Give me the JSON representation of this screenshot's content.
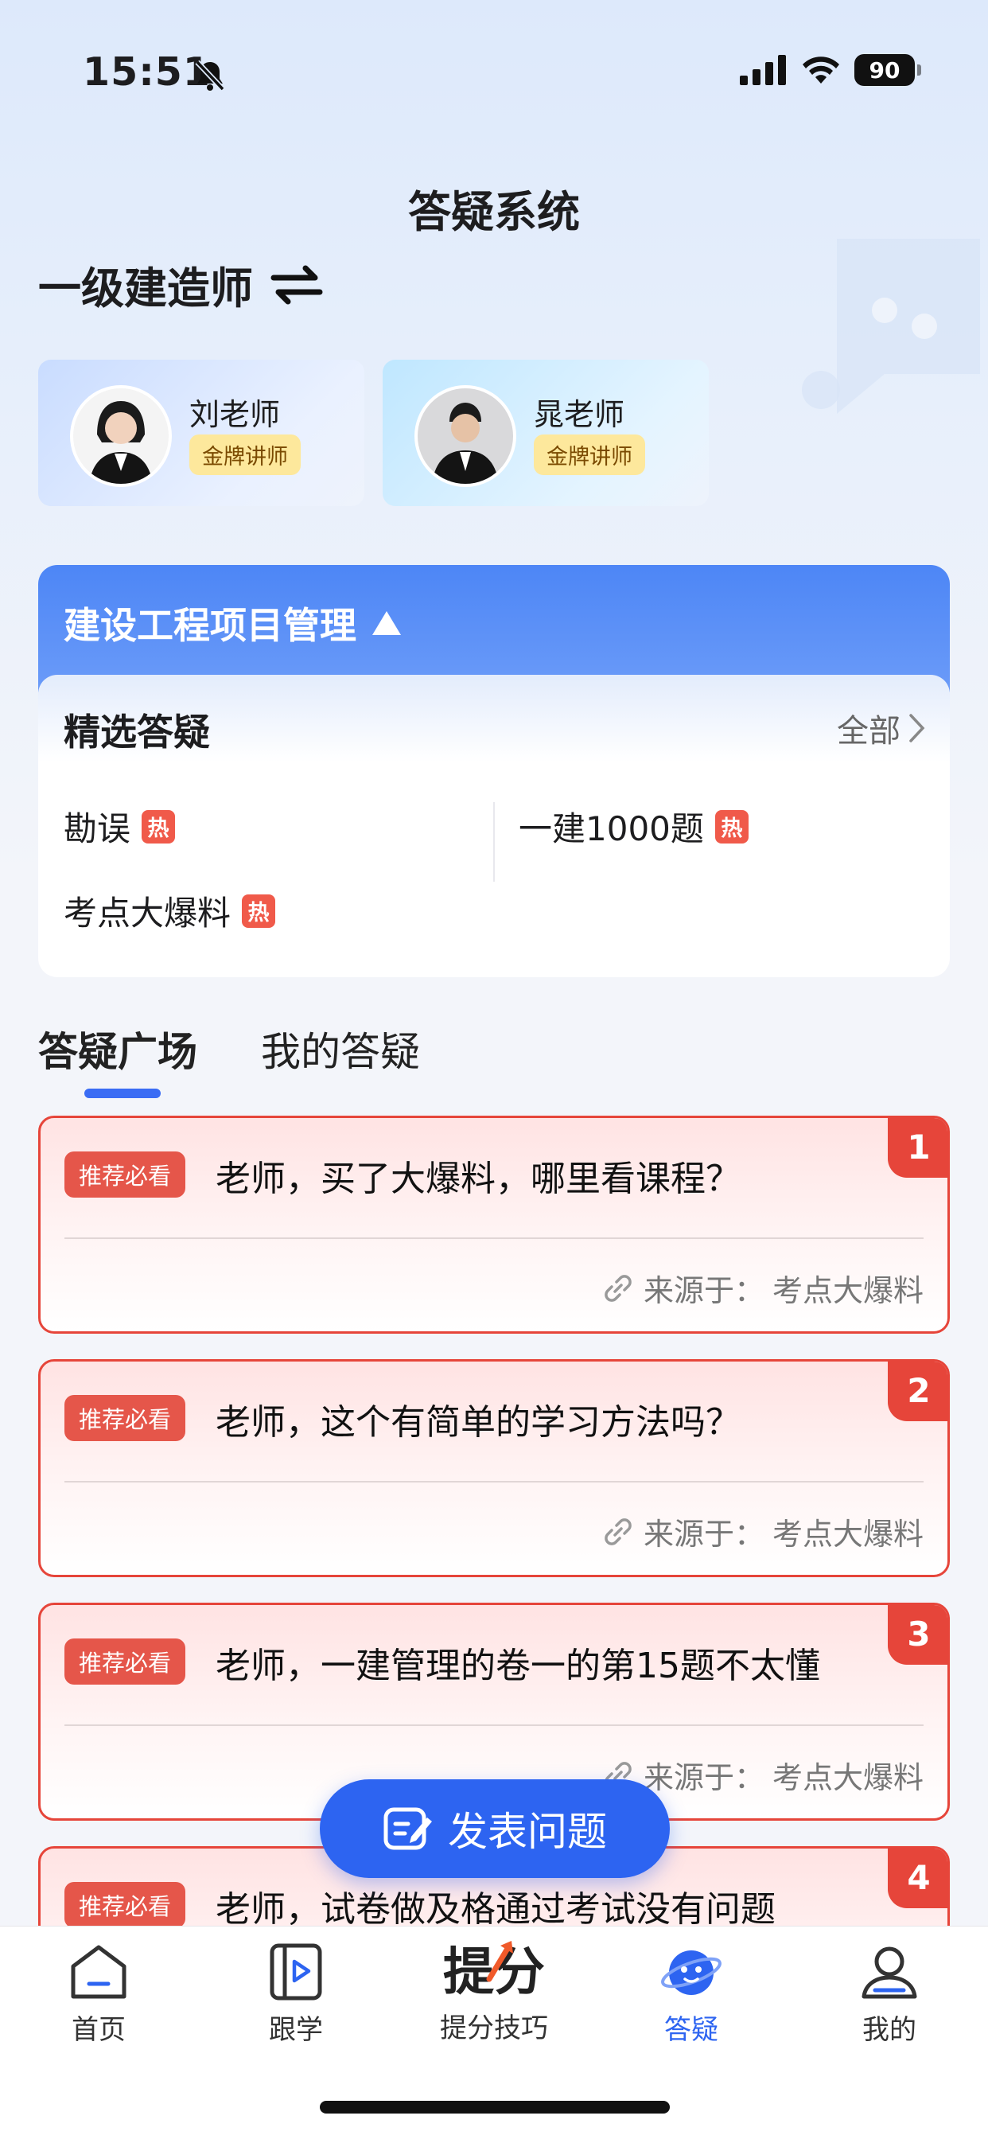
{
  "status_bar": {
    "time": "15:51",
    "battery": "90"
  },
  "header": {
    "title": "答疑系统"
  },
  "subject": {
    "title": "一级建造师"
  },
  "teachers": [
    {
      "name": "刘老师",
      "badge": "金牌讲师"
    },
    {
      "name": "晁老师",
      "badge": "金牌讲师"
    }
  ],
  "course": {
    "title": "建设工程项目管理"
  },
  "featured": {
    "title": "精选答疑",
    "all_label": "全部",
    "items": [
      {
        "label": "勘误",
        "hot": "热"
      },
      {
        "label": "一建1000题",
        "hot": "热"
      },
      {
        "label": "考点大爆料",
        "hot": "热"
      }
    ]
  },
  "tabs": [
    {
      "label": "答疑广场",
      "active": true
    },
    {
      "label": "我的答疑",
      "active": false
    }
  ],
  "questions": [
    {
      "rank": "1",
      "tag": "推荐必看",
      "text": "老师，买了大爆料，哪里看课程？",
      "source_label": "来源于：",
      "source": "考点大爆料"
    },
    {
      "rank": "2",
      "tag": "推荐必看",
      "text": "老师，这个有简单的学习方法吗？",
      "source_label": "来源于：",
      "source": "考点大爆料"
    },
    {
      "rank": "3",
      "tag": "推荐必看",
      "text": "老师，一建管理的卷一的第15题不太懂",
      "source_label": "来源于：",
      "source": "考点大爆料"
    },
    {
      "rank": "4",
      "tag": "推荐必看",
      "text": "老师，试卷做及格通过考试没有问题"
    }
  ],
  "fab": {
    "label": "发表问题"
  },
  "tabbar": [
    {
      "label": "首页",
      "icon": "home-icon"
    },
    {
      "label": "跟学",
      "icon": "play-book-icon"
    },
    {
      "label": "提分技巧",
      "logo_text": "提分",
      "icon": "score-up-logo"
    },
    {
      "label": "答疑",
      "icon": "qa-planet-icon",
      "active": true
    },
    {
      "label": "我的",
      "icon": "user-icon"
    }
  ],
  "colors": {
    "primary": "#2d64f1",
    "hot_red": "#e6453a",
    "badge_gold": "#fde89c"
  }
}
